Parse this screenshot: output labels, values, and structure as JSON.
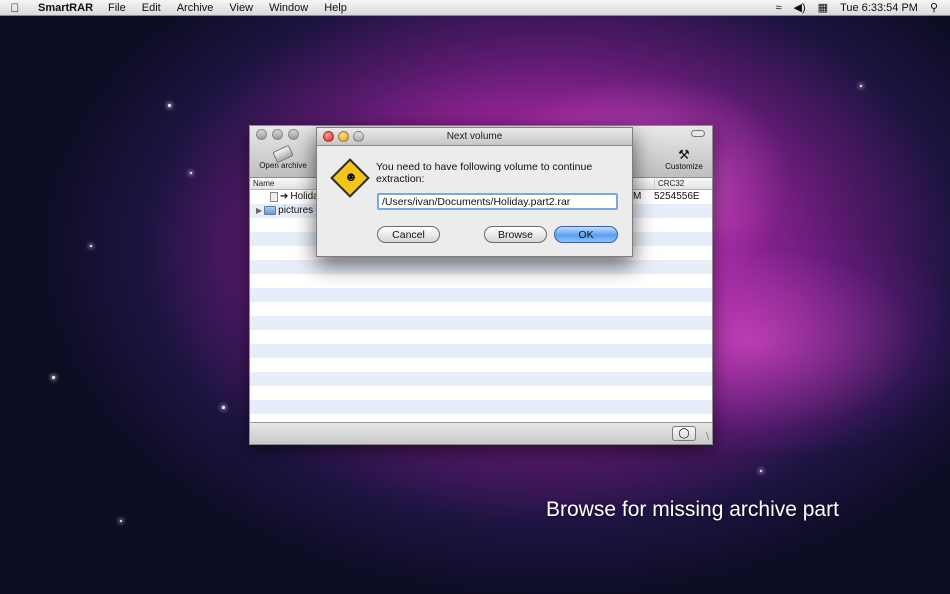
{
  "menubar": {
    "apple_icon": "apple-logo-icon",
    "app_name": "SmartRAR",
    "items": [
      "File",
      "Edit",
      "Archive",
      "View",
      "Window"
    ],
    "help": "Help",
    "clock": "Tue 6:33:54 PM",
    "status_icons": [
      "wifi-icon",
      "volume-icon",
      "battery-icon",
      "spotlight-icon"
    ]
  },
  "window": {
    "toolbar": {
      "open_label": "Open archive",
      "customize_label": "Customize"
    },
    "columns": {
      "name": "Name",
      "crc": "CRC32"
    },
    "rows": [
      {
        "name": "Holida",
        "size": "M",
        "crc": "5254556E",
        "kind": "file"
      },
      {
        "name": "pictures",
        "size": "",
        "crc": "",
        "kind": "folder"
      }
    ]
  },
  "dialog": {
    "title": "Next volume",
    "message": "You need to have following volume to continue extraction:",
    "path_value": "/Users/ivan/Documents/Holiday.part2.rar",
    "cancel_label": "Cancel",
    "browse_label": "Browse",
    "ok_label": "OK"
  },
  "caption": "Browse for missing archive part"
}
